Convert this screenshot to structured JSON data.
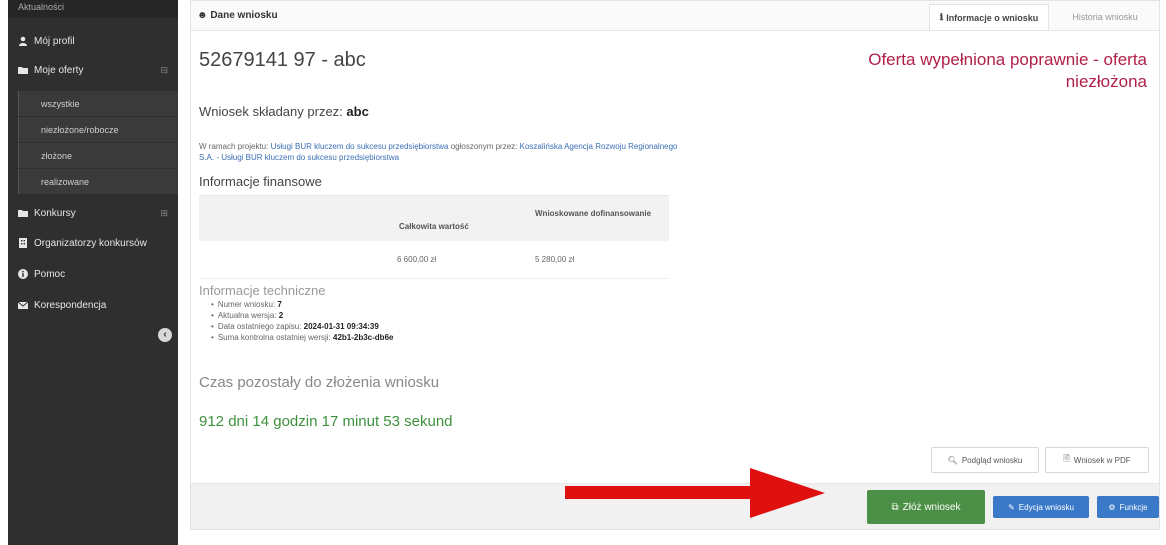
{
  "sidebar": {
    "top_label": "Aktualności",
    "items": [
      {
        "label": "Mój profil",
        "icon": "user-icon"
      },
      {
        "label": "Moje oferty",
        "icon": "folder-icon"
      },
      {
        "label": "Konkursy",
        "icon": "folder-icon"
      },
      {
        "label": "Organizatorzy konkursów",
        "icon": "building-icon"
      },
      {
        "label": "Pomoc",
        "icon": "info-icon"
      },
      {
        "label": "Korespondencja",
        "icon": "envelope-icon"
      }
    ],
    "submenu": [
      "wszystkie",
      "niezłożone/robocze",
      "złożone",
      "realizowane"
    ]
  },
  "panel": {
    "title": "Dane wniosku",
    "tabs": [
      "Informacje o wniosku",
      "Historia wniosku"
    ]
  },
  "application": {
    "number": "52679141 97 - abc",
    "status": "Oferta wypełniona poprawnie - oferta niezłożona",
    "submitted_by_prefix": "Wniosek składany przez:",
    "submitted_by": "abc",
    "project_prefix": "W ramach projektu:",
    "project_name": "Usługi BUR kluczem do sukcesu przedsiębiorstwa",
    "announced_by_prefix": "ogłoszonym przez:",
    "announcer": "Koszalińska Agencja Rozwoju Regionalnego S.A. - Usługi BUR kluczem do sukcesu przedsiębiorstwa"
  },
  "finance": {
    "title": "Informacje finansowe",
    "headers": [
      "Całkowita wartość",
      "Wnioskowane dofinansowanie"
    ],
    "values": [
      "6 600,00 zł",
      "5 280,00 zł"
    ]
  },
  "tech": {
    "title": "Informacje techniczne",
    "items": [
      {
        "label": "Numer wniosku:",
        "value": "7"
      },
      {
        "label": "Aktualna wersja:",
        "value": "2"
      },
      {
        "label": "Data ostatniego zapisu:",
        "value": "2024-01-31 09:34:39"
      },
      {
        "label": "Suma kontrolna ostatniej wersji:",
        "value": "42b1-2b3c-db6e"
      }
    ]
  },
  "deadline": {
    "title": "Czas pozostały do złożenia wniosku",
    "value": "912 dni 14 godzin 17 minut 53 sekund"
  },
  "buttons": {
    "preview": "Podgląd wniosku",
    "pdf": "Wniosek w PDF",
    "submit": "Złóż wniosek",
    "edit": "Edycja wniosku",
    "functions": "Funkcje"
  },
  "colors": {
    "status": "#b0204a",
    "deadline": "#3f9140",
    "submit": "#4c8f46",
    "primary": "#3a78c8",
    "arrow": "#e01010"
  }
}
